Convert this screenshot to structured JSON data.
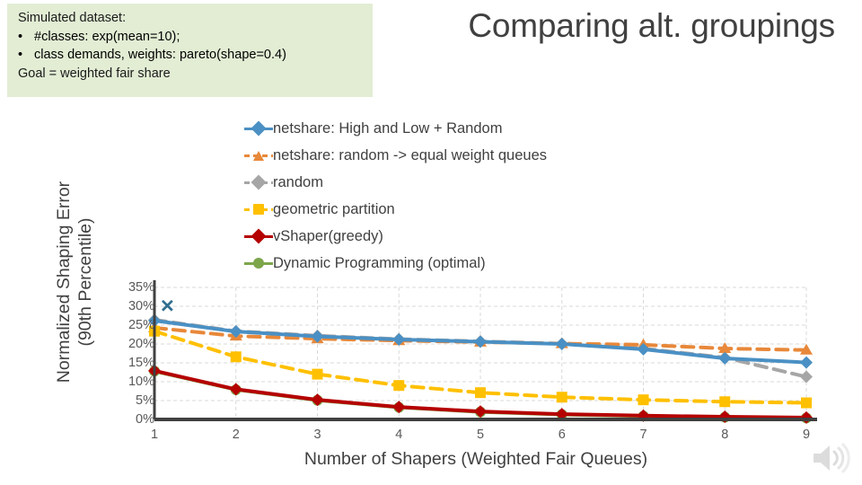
{
  "callout": {
    "heading": "Simulated dataset:",
    "bullets": [
      {
        "marker": "•",
        "text": "#classes: exp(mean=10);"
      },
      {
        "marker": "•",
        "text": "class demands, weights: pareto(shape=0.4)"
      }
    ],
    "footer": "Goal = weighted fair share",
    "background_color": "#E2EDD4"
  },
  "slide": {
    "title": "Comparing alt. groupings",
    "title_color": "#404040",
    "background_color": "#FFFFFF"
  },
  "icons": {
    "speaker": "speaker-icon"
  },
  "chart_data": {
    "type": "line",
    "title": "",
    "xlabel": "Number of Shapers (Weighted Fair Queues)",
    "ylabel": "Normalized Shaping Error (90th Percentile)",
    "x": [
      1,
      2,
      3,
      4,
      5,
      6,
      7,
      8,
      9
    ],
    "xticklabels": [
      "1",
      "2",
      "3",
      "4",
      "5",
      "6",
      "7",
      "8",
      "9"
    ],
    "yticklabels": [
      "35%",
      "30%",
      "25%",
      "20%",
      "15%",
      "10%",
      "5%",
      "0%"
    ],
    "ylim": [
      0,
      35
    ],
    "xlim": [
      1,
      9
    ],
    "ytick_values": [
      35,
      30,
      25,
      20,
      15,
      10,
      5,
      0
    ],
    "grid": true,
    "grid_color": "#D9D9D9",
    "legend_position": "above-plot",
    "series": [
      {
        "name": "netshare: High and Low + Random",
        "color": "#4A90C4",
        "marker": "diamond",
        "dash": "solid",
        "values": [
          26.2,
          23.3,
          22.0,
          21.2,
          20.6,
          20.0,
          18.6,
          16.2,
          15.1
        ]
      },
      {
        "name": "netshare: random -> equal weight queues",
        "color": "#E8883A",
        "marker": "triangle",
        "dash": "dashed",
        "values": [
          24.3,
          22.1,
          21.4,
          20.9,
          20.5,
          20.1,
          19.8,
          18.8,
          18.4
        ]
      },
      {
        "name": "random",
        "color": "#A6A6A6",
        "marker": "diamond",
        "dash": "dashed",
        "values": [
          26.4,
          23.4,
          22.2,
          21.3,
          20.7,
          20.1,
          18.8,
          16.4,
          11.3
        ]
      },
      {
        "name": "geometric partition",
        "color": "#FFC000",
        "marker": "square",
        "dash": "dashed",
        "values": [
          23.4,
          16.6,
          12.0,
          9.0,
          7.1,
          5.9,
          5.2,
          4.7,
          4.4
        ]
      },
      {
        "name": "vShaper(greedy)",
        "color": "#B50000",
        "marker": "diamond",
        "dash": "solid",
        "values": [
          12.9,
          8.0,
          5.2,
          3.3,
          2.1,
          1.4,
          1.0,
          0.7,
          0.5
        ]
      },
      {
        "name": "Dynamic Programming (optimal)",
        "color": "#7DA64B",
        "marker": "circle",
        "dash": "solid",
        "values": [
          12.8,
          7.9,
          5.1,
          3.2,
          2.0,
          1.3,
          0.9,
          0.6,
          0.4
        ]
      }
    ],
    "annotations": [
      {
        "name": "x-marker",
        "x": 1,
        "y": 30.1,
        "color": "#2E6E8E",
        "glyph": "✕"
      }
    ]
  }
}
